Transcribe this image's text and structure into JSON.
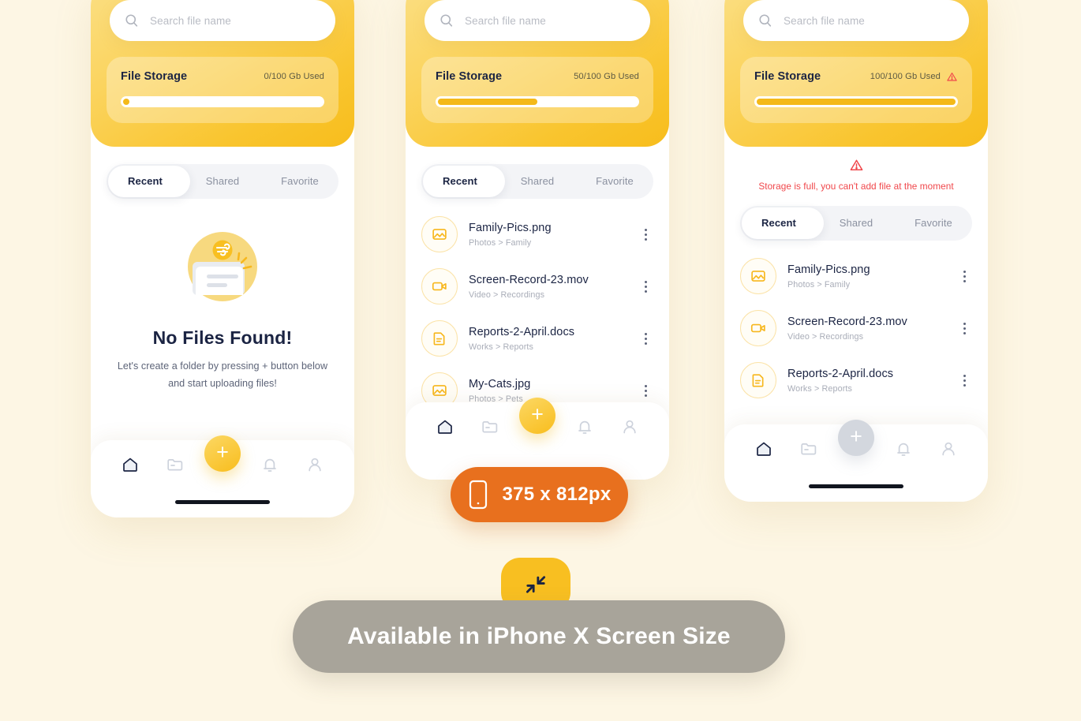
{
  "background_color": "#fdf6e4",
  "accent_color": "#f8bf21",
  "danger_color": "#f0474b",
  "badge_color": "#e8701e",
  "search": {
    "placeholder": "Search file name",
    "value": "",
    "icon": "search-icon"
  },
  "storage": {
    "title": "File Storage",
    "states": [
      {
        "used_label": "0/100 Gb Used",
        "percent": 0,
        "warning": false
      },
      {
        "used_label": "50/100 Gb Used",
        "percent": 50,
        "warning": false
      },
      {
        "used_label": "100/100 Gb Used",
        "percent": 100,
        "warning": true
      }
    ]
  },
  "alert": {
    "icon": "warning-triangle-icon",
    "message": "Storage is full, you can't add file at the moment"
  },
  "tabs": [
    {
      "label": "Recent",
      "active": true
    },
    {
      "label": "Shared",
      "active": false
    },
    {
      "label": "Favorite",
      "active": false
    }
  ],
  "empty_state": {
    "illustration": "empty-folder-illustration",
    "title": "No Files Found!",
    "line1": "Let's create a folder by pressing + button below",
    "line2": "and start uploading files!"
  },
  "files": [
    {
      "name": "Family-Pics.png",
      "path": "Photos > Family",
      "icon": "image-file-icon"
    },
    {
      "name": "Screen-Record-23.mov",
      "path": "Video > Recordings",
      "icon": "video-file-icon"
    },
    {
      "name": "Reports-2-April.docs",
      "path": "Works > Reports",
      "icon": "document-file-icon"
    },
    {
      "name": "My-Cats.jpg",
      "path": "Photos > Pets",
      "icon": "image-file-icon"
    }
  ],
  "nav": {
    "items": [
      {
        "name": "home-icon",
        "active": true
      },
      {
        "name": "folder-icon",
        "active": false
      },
      {
        "name": "bell-icon",
        "active": false
      },
      {
        "name": "profile-icon",
        "active": false
      }
    ],
    "fab": {
      "label": "+",
      "icon": "plus-icon",
      "disabled_on_full": true
    }
  },
  "size_badge": {
    "label": "375 x 812px",
    "icon": "phone-icon"
  },
  "bottom_banner": {
    "label": "Available in iPhone X Screen Size",
    "chip_icon": "shrink-arrows-icon"
  }
}
